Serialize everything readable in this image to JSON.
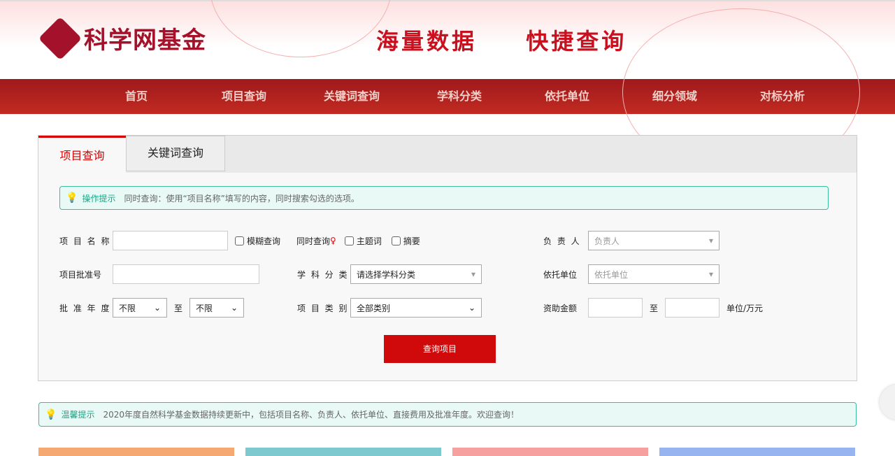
{
  "header": {
    "logo_text": "科学网基金",
    "slogan": "海量数据  快捷查询"
  },
  "nav": [
    "首页",
    "项目查询",
    "关键词查询",
    "学科分类",
    "依托单位",
    "细分领域",
    "对标分析"
  ],
  "tabs": [
    "项目查询",
    "关键词查询"
  ],
  "tip": {
    "title": "操作提示",
    "text": "同时查询：使用“项目名称”填写的内容，同时搜索勾选的选项。"
  },
  "form": {
    "name_label": "项 目 名 称",
    "fuzzy": "模糊查询",
    "simul": "同时查询",
    "subject_word": "主题词",
    "abstract": "摘要",
    "leader_label": "负 责 人",
    "leader_placeholder": "负责人",
    "approval_label": "项目批准号",
    "discipline_label": "学 科 分 类",
    "discipline_value": "请选择学科分类",
    "unit_label": "依托单位",
    "unit_placeholder": "依托单位",
    "year_label": "批 准 年 度",
    "year_from": "不限",
    "to": "至",
    "year_to": "不限",
    "type_label": "项 目 类 别",
    "type_value": "全部类别",
    "amount_label": "资助金额",
    "amount_unit": "单位/万元",
    "submit": "查询项目"
  },
  "notice": {
    "title": "温馨提示",
    "text": "2020年度自然科学基金数据持续更新中，包括项目名称、负责人、依托单位、直接费用及批准年度。欢迎查询！"
  },
  "card_colors": [
    "#f5a872",
    "#7ec8cf",
    "#f7a0a0",
    "#98b4f0"
  ]
}
